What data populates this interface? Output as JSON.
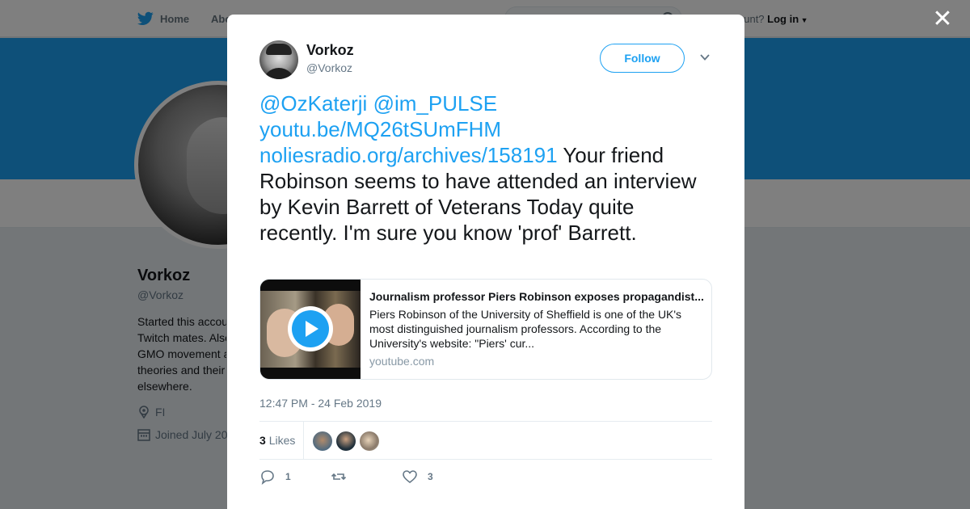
{
  "background": {
    "nav": {
      "home_label": "Home",
      "about_label": "Abo",
      "login_prompt": "ount?",
      "login_label": "Log in"
    },
    "profile": {
      "name": "Vorkoz",
      "handle": "@Vorkoz",
      "bio_lines": [
        "Started this accou",
        "Twitch mates. Also",
        "GMO movement a",
        "theories and their",
        "elsewhere."
      ],
      "location": "FI",
      "joined": "Joined July 20"
    }
  },
  "modal": {
    "author": {
      "name": "Vorkoz",
      "handle": "@Vorkoz",
      "follow_label": "Follow"
    },
    "tweet": {
      "mention1": "@OzKaterji",
      "mention2": "@im_PULSE",
      "link1": "youtu.be/MQ26tSUmFHM",
      "link2": "noliesradio.org/archives/158191",
      "text": "Your friend Robinson seems to have attended an interview by Kevin Barrett of Veterans Today quite recently. I'm sure you know 'prof' Barrett."
    },
    "card": {
      "title": "Journalism professor Piers Robinson exposes propagandist...",
      "description": "Piers Robinson of the University of Sheffield is one of the UK's most distinguished journalism professors. According to the University's website: \"Piers' cur...",
      "domain": "youtube.com"
    },
    "timestamp": "12:47 PM - 24 Feb 2019",
    "likes_count": "3",
    "likes_label": "Likes",
    "actions": {
      "reply_count": "1",
      "retweet_count": "",
      "like_count": "3"
    }
  },
  "colors": {
    "accent": "#1da1f2",
    "text": "#14171a",
    "muted": "#657786"
  }
}
